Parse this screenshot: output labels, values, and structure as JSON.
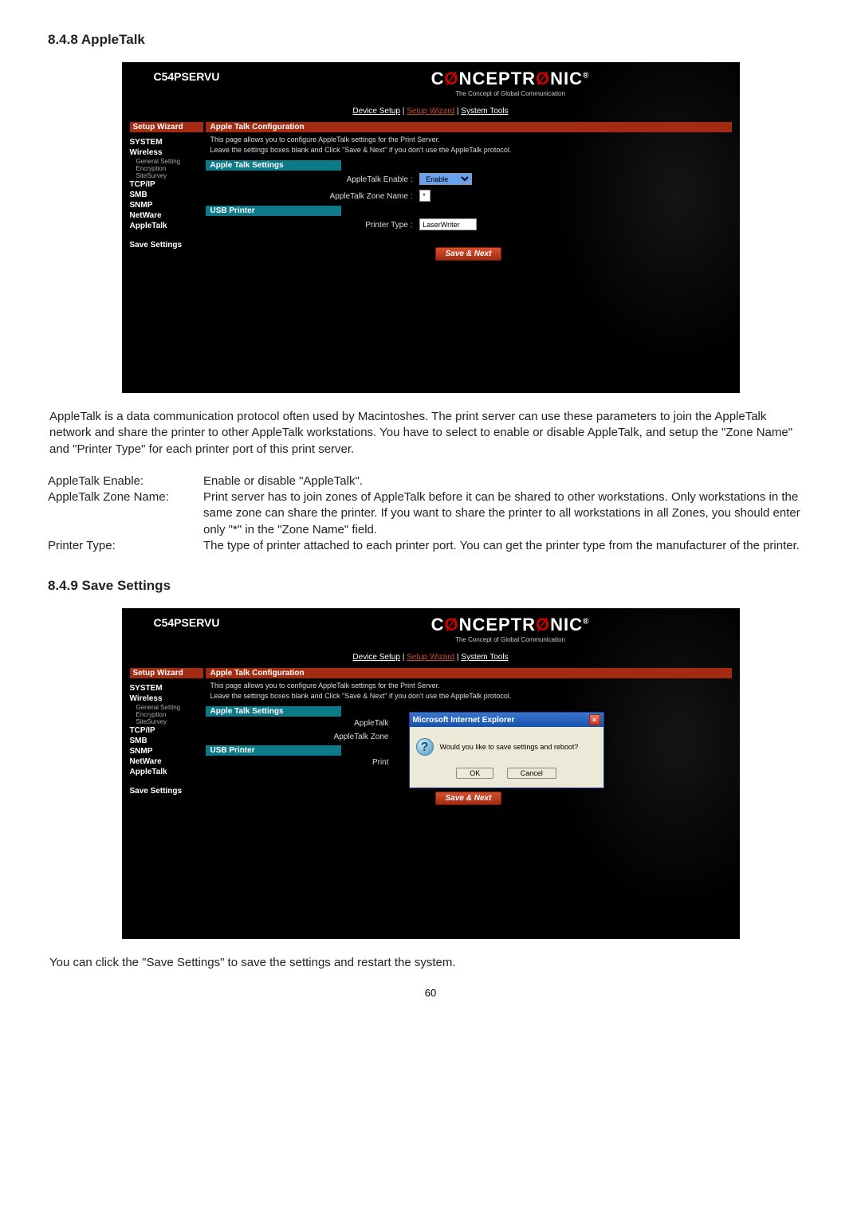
{
  "page_number": "60",
  "section1": {
    "heading": "8.4.8 AppleTalk"
  },
  "section2": {
    "heading": "8.4.9 Save Settings"
  },
  "screenshot_common": {
    "product": "C54PSERVU",
    "brand_pre": "C",
    "brand_mid": "Ø",
    "brand_post": "NCEPTR",
    "brand_mid2": "Ø",
    "brand_post2": "NIC",
    "brand_reg": "®",
    "tagline": "The Concept of Global Communication",
    "nav_device": "Device Setup",
    "nav_wizard": "Setup Wizard",
    "nav_tools": "System Tools",
    "sidebar": {
      "setup_wizard": "Setup Wizard",
      "system": "SYSTEM",
      "wireless": "Wireless",
      "general_setting": "General Setting",
      "encryption": "Encryption",
      "sitesurvey": "SiteSurvey",
      "tcpip": "TCP/IP",
      "smb": "SMB",
      "snmp": "SNMP",
      "netware": "NetWare",
      "appletalk": "AppleTalk",
      "save_settings": "Save Settings"
    },
    "cfg": {
      "title": "Apple Talk Configuration",
      "desc1": "This page allows you to configure AppleTalk settings for the Print Server.",
      "desc2": "Leave the settings boxes blank and Click \"Save & Next\" if you don't use the AppleTalk protocol.",
      "settings_title": "Apple Talk Settings",
      "enable_label": "AppleTalk Enable :",
      "enable_value": "Enable",
      "zone_label": "AppleTalk Zone Name :",
      "zone_value": "*",
      "usb_title": "USB Printer",
      "printer_type_label": "Printer Type :",
      "printer_type_value": "LaserWriter",
      "save_btn": "Save & Next"
    }
  },
  "dialog": {
    "title": "Microsoft Internet Explorer",
    "message": "Would you like to save settings and reboot?",
    "ok": "OK",
    "cancel": "Cancel"
  },
  "body1": "AppleTalk is a data communication protocol often used by Macintoshes. The print server can use these parameters to join the AppleTalk network and share the printer to other AppleTalk workstations. You have to select to enable or disable AppleTalk, and setup the \"Zone Name\" and \"Printer Type\" for each printer port of this print server.",
  "defs": {
    "enable_label": "AppleTalk Enable:",
    "enable_desc": "Enable or disable \"AppleTalk\".",
    "zone_label": "AppleTalk Zone Name:",
    "zone_desc": "Print server has to join zones of AppleTalk before it can be shared to other workstations. Only workstations in the same zone can share the printer. If you want to share the printer to all workstations in all Zones, you should enter only \"*\" in the \"Zone Name\" field.",
    "ptype_label": "Printer Type:",
    "ptype_desc": "The type of printer attached to each printer port. You can get the printer type from the manufacturer of the printer."
  },
  "body2": "You can click the \"Save Settings\" to save the settings and restart the system."
}
